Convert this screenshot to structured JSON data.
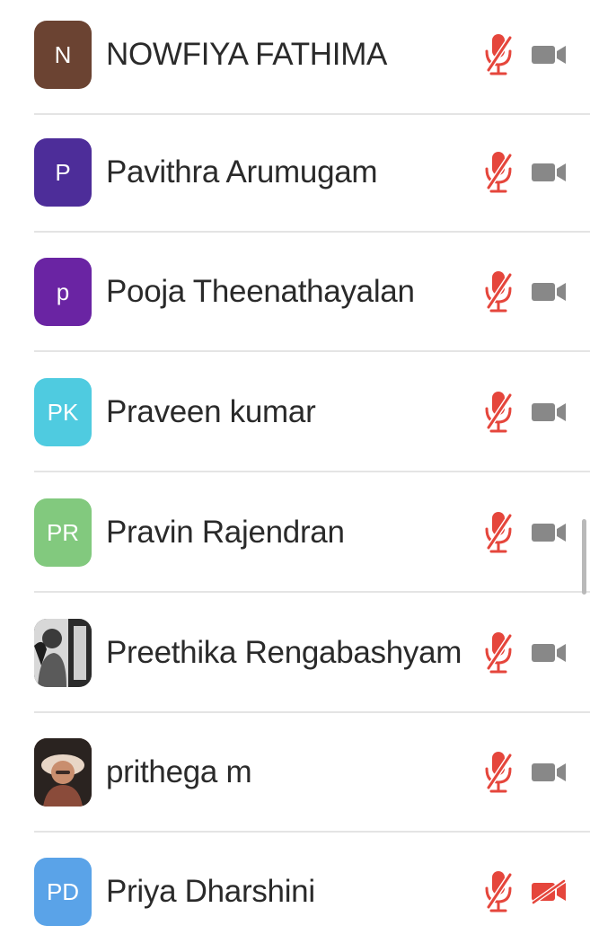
{
  "participants": [
    {
      "initials": "N",
      "name": "NOWFIYA FATHIMA",
      "avatar_color": "#6b4332",
      "avatar_type": "initials",
      "video_muted": false
    },
    {
      "initials": "P",
      "name": "Pavithra Arumugam",
      "avatar_color": "#4d2d99",
      "avatar_type": "initials",
      "video_muted": false
    },
    {
      "initials": "p",
      "name": "Pooja Theenathayalan",
      "avatar_color": "#6a24a3",
      "avatar_type": "initials",
      "video_muted": false
    },
    {
      "initials": "PK",
      "name": "Praveen kumar",
      "avatar_color": "#4fcbe0",
      "avatar_type": "initials",
      "video_muted": false
    },
    {
      "initials": "PR",
      "name": "Pravin Rajendran",
      "avatar_color": "#82c97e",
      "avatar_type": "initials",
      "video_muted": false
    },
    {
      "initials": "",
      "name": "Preethika Rengabashyam",
      "avatar_color": "#3a3a3a",
      "avatar_type": "photo-bw",
      "video_muted": false
    },
    {
      "initials": "",
      "name": "prithega m",
      "avatar_color": "#7a4a3a",
      "avatar_type": "photo-color",
      "video_muted": false
    },
    {
      "initials": "PD",
      "name": "Priya Dharshini",
      "avatar_color": "#5aa3e8",
      "avatar_type": "initials",
      "video_muted": true
    }
  ],
  "icons": {
    "mic": "microphone-muted-icon",
    "cam": "video-camera-icon",
    "cam_muted": "video-camera-muted-icon"
  },
  "colors": {
    "muted_red": "#e5463c",
    "camera_gray": "#888888",
    "divider": "#e4e4e4",
    "text": "#2a2a2a"
  }
}
